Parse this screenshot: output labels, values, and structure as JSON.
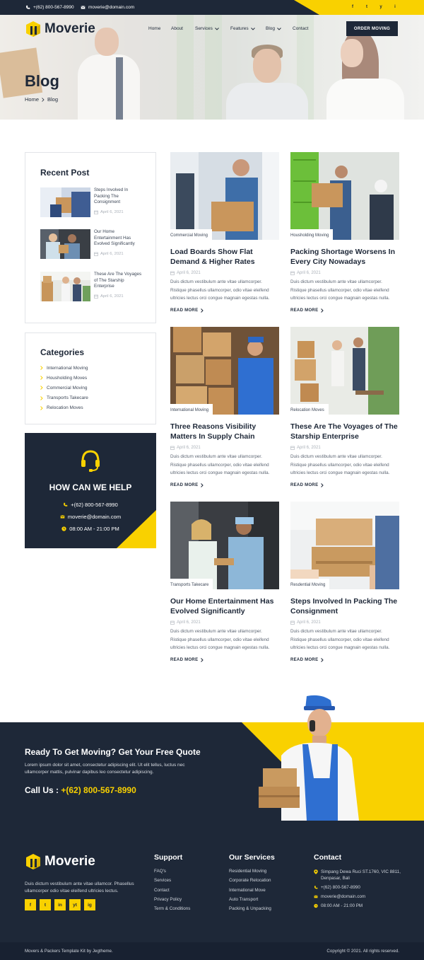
{
  "topbar": {
    "phone": "+(62) 800-567-8990",
    "email": "moverie@domain.com",
    "social": [
      "f",
      "t",
      "y",
      "i"
    ]
  },
  "brand": {
    "name": "Moverie",
    "accent": "#f9d100",
    "dark": "#1e2838"
  },
  "nav": {
    "items": [
      {
        "label": "Home"
      },
      {
        "label": "About"
      },
      {
        "label": "Services"
      },
      {
        "label": "Features"
      },
      {
        "label": "Blog"
      },
      {
        "label": "Contact"
      }
    ],
    "cta": "ORDER MOVING"
  },
  "hero": {
    "title": "Blog",
    "breadcrumb": [
      "Home",
      "Blog"
    ]
  },
  "recent": {
    "title": "Recent Post",
    "items": [
      {
        "title": "Steps Involved In Packing The Consignment",
        "date": "April 6, 2021"
      },
      {
        "title": "Our Home Entertainment Has Evolved Significantly",
        "date": "April 6, 2021"
      },
      {
        "title": "These Are The Voyages of The Starship Enterprise",
        "date": "April 6, 2021"
      }
    ]
  },
  "categories": {
    "title": "Categories",
    "items": [
      "International Moving",
      "Housholding Moves",
      "Commercial Moving",
      "Transports Takecare",
      "Relocation Moves"
    ]
  },
  "help": {
    "title": "HOW CAN WE HELP",
    "phone": "+(62) 800-567-8990",
    "email": "moverie@domain.com",
    "hours": "08:00 AM - 21:00 PM"
  },
  "posts": [
    {
      "tag": "Commercial Moving",
      "title": "Load Boards Show Flat Demand & Higher Rates",
      "date": "April 6, 2021",
      "excerpt": "Duis dictum vestibulum ante vitae ullamcorper. Ristique phasellus ullamcorper, odio vitae eleifend ultricies lectus orci congue magnain egestas nulla.",
      "more": "READ MORE"
    },
    {
      "tag": "Housholding Moving",
      "title": "Packing Shortage Worsens In Every City Nowadays",
      "date": "April 6, 2021",
      "excerpt": "Duis dictum vestibulum ante vitae ullamcorper. Ristique phasellus ullamcorper, odio vitae eleifend ultricies lectus orci congue magnain egestas nulla.",
      "more": "READ MORE"
    },
    {
      "tag": "International Moving",
      "title": "Three Reasons Visibility Matters In Supply Chain",
      "date": "April 6, 2021",
      "excerpt": "Duis dictum vestibulum ante vitae ullamcorper. Ristique phasellus ullamcorper, odio vitae eleifend ultricies lectus orci congue magnain egestas nulla.",
      "more": "READ MORE"
    },
    {
      "tag": "Relocation Moves",
      "title": "These Are The Voyages of The Starship Enterprise",
      "date": "April 6, 2021",
      "excerpt": "Duis dictum vestibulum ante vitae ullamcorper. Ristique phasellus ullamcorper, odio vitae eleifend ultricies lectus orci congue magnain egestas nulla.",
      "more": "READ MORE"
    },
    {
      "tag": "Transports Takecare",
      "title": "Our Home Entertainment Has Evolved Significantly",
      "date": "April 6, 2021",
      "excerpt": "Duis dictum vestibulum ante vitae ullamcorper. Ristique phasellus ullamcorper, odio vitae eleifend ultricies lectus orci congue magnain egestas nulla.",
      "more": "READ MORE"
    },
    {
      "tag": "Resdential Moving",
      "title": "Steps Involved In Packing The Consignment",
      "date": "April 6, 2021",
      "excerpt": "Duis dictum vestibulum ante vitae ullamcorper. Ristique phasellus ullamcorper, odio vitae eleifend ultricies lectus orci congue magnain egestas nulla.",
      "more": "READ MORE"
    }
  ],
  "cta": {
    "title": "Ready To Get Moving? Get Your Free Quote",
    "text": "Lorem ipsum dolor sit amet, consectetur adipiscing elit. Ut elit tellus, luctus nec ullamcorper mattis, pulvinar dapibus leo consectetur adipiscing.",
    "call_label": "Call Us :",
    "call_number": "+(62) 800-567-8990"
  },
  "footer": {
    "desc": "Duis dictum vestibulum ante vitae ullamcor. Phasellus ullamcorper odio vitae eleifend ultricies lectus.",
    "social": [
      "f",
      "t",
      "in",
      "yt",
      "ig"
    ],
    "support": {
      "title": "Support",
      "items": [
        "FAQ's",
        "Services",
        "Contact",
        "Privacy Policy",
        "Term & Conditions"
      ]
    },
    "services": {
      "title": "Our Services",
      "items": [
        "Residential Moving",
        "Corporate Relocation",
        "International Move",
        "Auto Transport",
        "Packing & Unpacking"
      ]
    },
    "contact": {
      "title": "Contact",
      "address": "Simpang Dewa Ruci ST.1760, VIC 8811, Denpasar, Bali",
      "phone": "+(62) 800-567-8990",
      "email": "moverie@domain.com",
      "hours": "08:00 AM - 21:00 PM"
    },
    "credit": "Movers & Packers Template Kit by Jegtheme.",
    "copyright": "Copyright © 2021. All rights reserved."
  }
}
